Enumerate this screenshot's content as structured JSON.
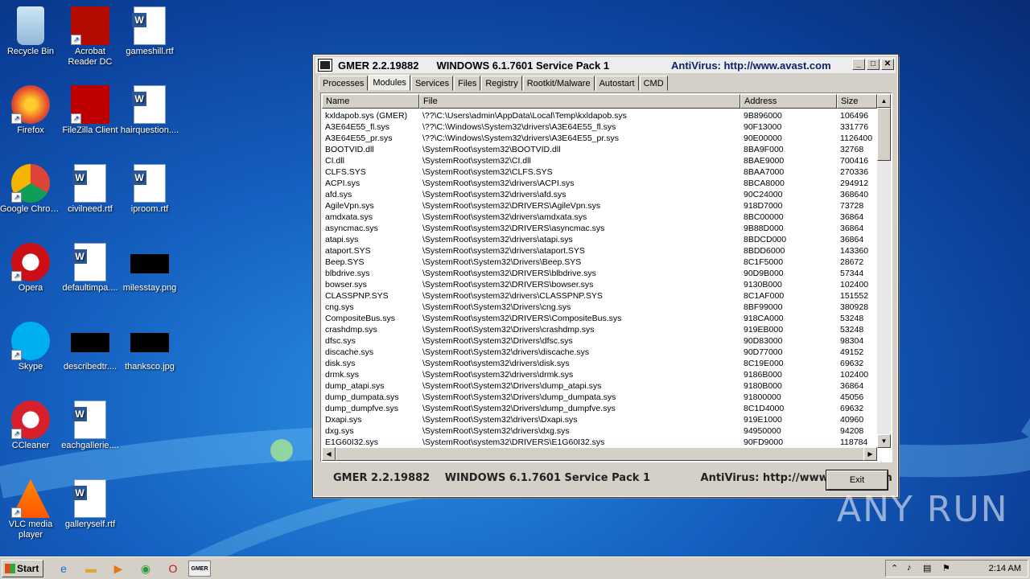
{
  "desktop_icons": [
    {
      "label": "Recycle Bin",
      "icon": "recycle-bin-icon"
    },
    {
      "label": "Acrobat Reader DC",
      "icon": "acrobat-icon"
    },
    {
      "label": "gameshill.rtf",
      "icon": "word-doc-icon"
    },
    {
      "label": "Firefox",
      "icon": "firefox-icon"
    },
    {
      "label": "FileZilla Client",
      "icon": "filezilla-icon"
    },
    {
      "label": "hairquestion....",
      "icon": "word-doc-icon"
    },
    {
      "label": "Google Chrome",
      "icon": "chrome-icon"
    },
    {
      "label": "civilneed.rtf",
      "icon": "word-doc-icon"
    },
    {
      "label": "iproom.rtf",
      "icon": "word-doc-icon"
    },
    {
      "label": "Opera",
      "icon": "opera-icon"
    },
    {
      "label": "defaultimpa....",
      "icon": "word-doc-icon"
    },
    {
      "label": "milesstay.png",
      "icon": "image-icon"
    },
    {
      "label": "Skype",
      "icon": "skype-icon"
    },
    {
      "label": "describedtr....",
      "icon": "image-icon"
    },
    {
      "label": "thanksco.jpg",
      "icon": "image-icon"
    },
    {
      "label": "CCleaner",
      "icon": "ccleaner-icon"
    },
    {
      "label": "eachgallerie....",
      "icon": "word-doc-icon"
    },
    {
      "label": "VLC media player",
      "icon": "vlc-icon"
    },
    {
      "label": "galleryself.rtf",
      "icon": "word-doc-icon"
    }
  ],
  "window": {
    "title_app": "GMER 2.2.19882",
    "title_os": "WINDOWS 6.1.7601 Service Pack 1",
    "title_av": "AntiVirus: http://www.avast.com",
    "tabs": [
      "Processes",
      "Modules",
      "Services",
      "Files",
      "Registry",
      "Rootkit/Malware",
      "Autostart",
      "CMD"
    ],
    "active_tab": "Modules",
    "columns": [
      "Name",
      "File",
      "Address",
      "Size"
    ],
    "rows": [
      [
        "kxldapob.sys (GMER)",
        "\\??\\C:\\Users\\admin\\AppData\\Local\\Temp\\kxldapob.sys",
        "9B896000",
        "106496"
      ],
      [
        "A3E64E55_fl.sys",
        "\\??\\C:\\Windows\\System32\\drivers\\A3E64E55_fl.sys",
        "90F13000",
        "331776"
      ],
      [
        "A3E64E55_pr.sys",
        "\\??\\C:\\Windows\\System32\\drivers\\A3E64E55_pr.sys",
        "90E00000",
        "1126400"
      ],
      [
        "BOOTVID.dll",
        "\\SystemRoot\\system32\\BOOTVID.dll",
        "8BA9F000",
        "32768"
      ],
      [
        "CI.dll",
        "\\SystemRoot\\system32\\CI.dll",
        "8BAE9000",
        "700416"
      ],
      [
        "CLFS.SYS",
        "\\SystemRoot\\system32\\CLFS.SYS",
        "8BAA7000",
        "270336"
      ],
      [
        "ACPI.sys",
        "\\SystemRoot\\system32\\drivers\\ACPI.sys",
        "8BCA8000",
        "294912"
      ],
      [
        "afd.sys",
        "\\SystemRoot\\system32\\drivers\\afd.sys",
        "90C24000",
        "368640"
      ],
      [
        "AgileVpn.sys",
        "\\SystemRoot\\system32\\DRIVERS\\AgileVpn.sys",
        "918D7000",
        "73728"
      ],
      [
        "amdxata.sys",
        "\\SystemRoot\\system32\\drivers\\amdxata.sys",
        "8BC00000",
        "36864"
      ],
      [
        "asyncmac.sys",
        "\\SystemRoot\\system32\\DRIVERS\\asyncmac.sys",
        "9B88D000",
        "36864"
      ],
      [
        "atapi.sys",
        "\\SystemRoot\\system32\\drivers\\atapi.sys",
        "8BDCD000",
        "36864"
      ],
      [
        "ataport.SYS",
        "\\SystemRoot\\system32\\drivers\\ataport.SYS",
        "8BDD6000",
        "143360"
      ],
      [
        "Beep.SYS",
        "\\SystemRoot\\System32\\Drivers\\Beep.SYS",
        "8C1F5000",
        "28672"
      ],
      [
        "blbdrive.sys",
        "\\SystemRoot\\system32\\DRIVERS\\blbdrive.sys",
        "90D9B000",
        "57344"
      ],
      [
        "bowser.sys",
        "\\SystemRoot\\system32\\DRIVERS\\bowser.sys",
        "9130B000",
        "102400"
      ],
      [
        "CLASSPNP.SYS",
        "\\SystemRoot\\system32\\drivers\\CLASSPNP.SYS",
        "8C1AF000",
        "151552"
      ],
      [
        "cng.sys",
        "\\SystemRoot\\System32\\Drivers\\cng.sys",
        "8BF99000",
        "380928"
      ],
      [
        "CompositeBus.sys",
        "\\SystemRoot\\system32\\DRIVERS\\CompositeBus.sys",
        "918CA000",
        "53248"
      ],
      [
        "crashdmp.sys",
        "\\SystemRoot\\System32\\Drivers\\crashdmp.sys",
        "919EB000",
        "53248"
      ],
      [
        "dfsc.sys",
        "\\SystemRoot\\System32\\Drivers\\dfsc.sys",
        "90D83000",
        "98304"
      ],
      [
        "discache.sys",
        "\\SystemRoot\\System32\\drivers\\discache.sys",
        "90D77000",
        "49152"
      ],
      [
        "disk.sys",
        "\\SystemRoot\\system32\\drivers\\disk.sys",
        "8C19E000",
        "69632"
      ],
      [
        "drmk.sys",
        "\\SystemRoot\\system32\\drivers\\drmk.sys",
        "9186B000",
        "102400"
      ],
      [
        "dump_atapi.sys",
        "\\SystemRoot\\System32\\Drivers\\dump_atapi.sys",
        "9180B000",
        "36864"
      ],
      [
        "dump_dumpata.sys",
        "\\SystemRoot\\System32\\Drivers\\dump_dumpata.sys",
        "91800000",
        "45056"
      ],
      [
        "dump_dumpfve.sys",
        "\\SystemRoot\\System32\\Drivers\\dump_dumpfve.sys",
        "8C1D4000",
        "69632"
      ],
      [
        "Dxapi.sys",
        "\\SystemRoot\\System32\\drivers\\Dxapi.sys",
        "919E1000",
        "40960"
      ],
      [
        "dxg.sys",
        "\\SystemRoot\\System32\\drivers\\dxg.sys",
        "94950000",
        "94208"
      ],
      [
        "E1G60I32.sys",
        "\\SystemRoot\\system32\\DRIVERS\\E1G60I32.sys",
        "90FD9000",
        "118784"
      ]
    ],
    "status_app": "GMER 2.2.19882",
    "status_os": "WINDOWS 6.1.7601 Service Pack 1",
    "status_av": "AntiVirus: http://www.avast.com",
    "exit_label": "Exit"
  },
  "taskbar": {
    "start_label": "Start",
    "clock": "2:14 AM",
    "app_button": "GMER"
  },
  "watermark": "ANY RUN"
}
